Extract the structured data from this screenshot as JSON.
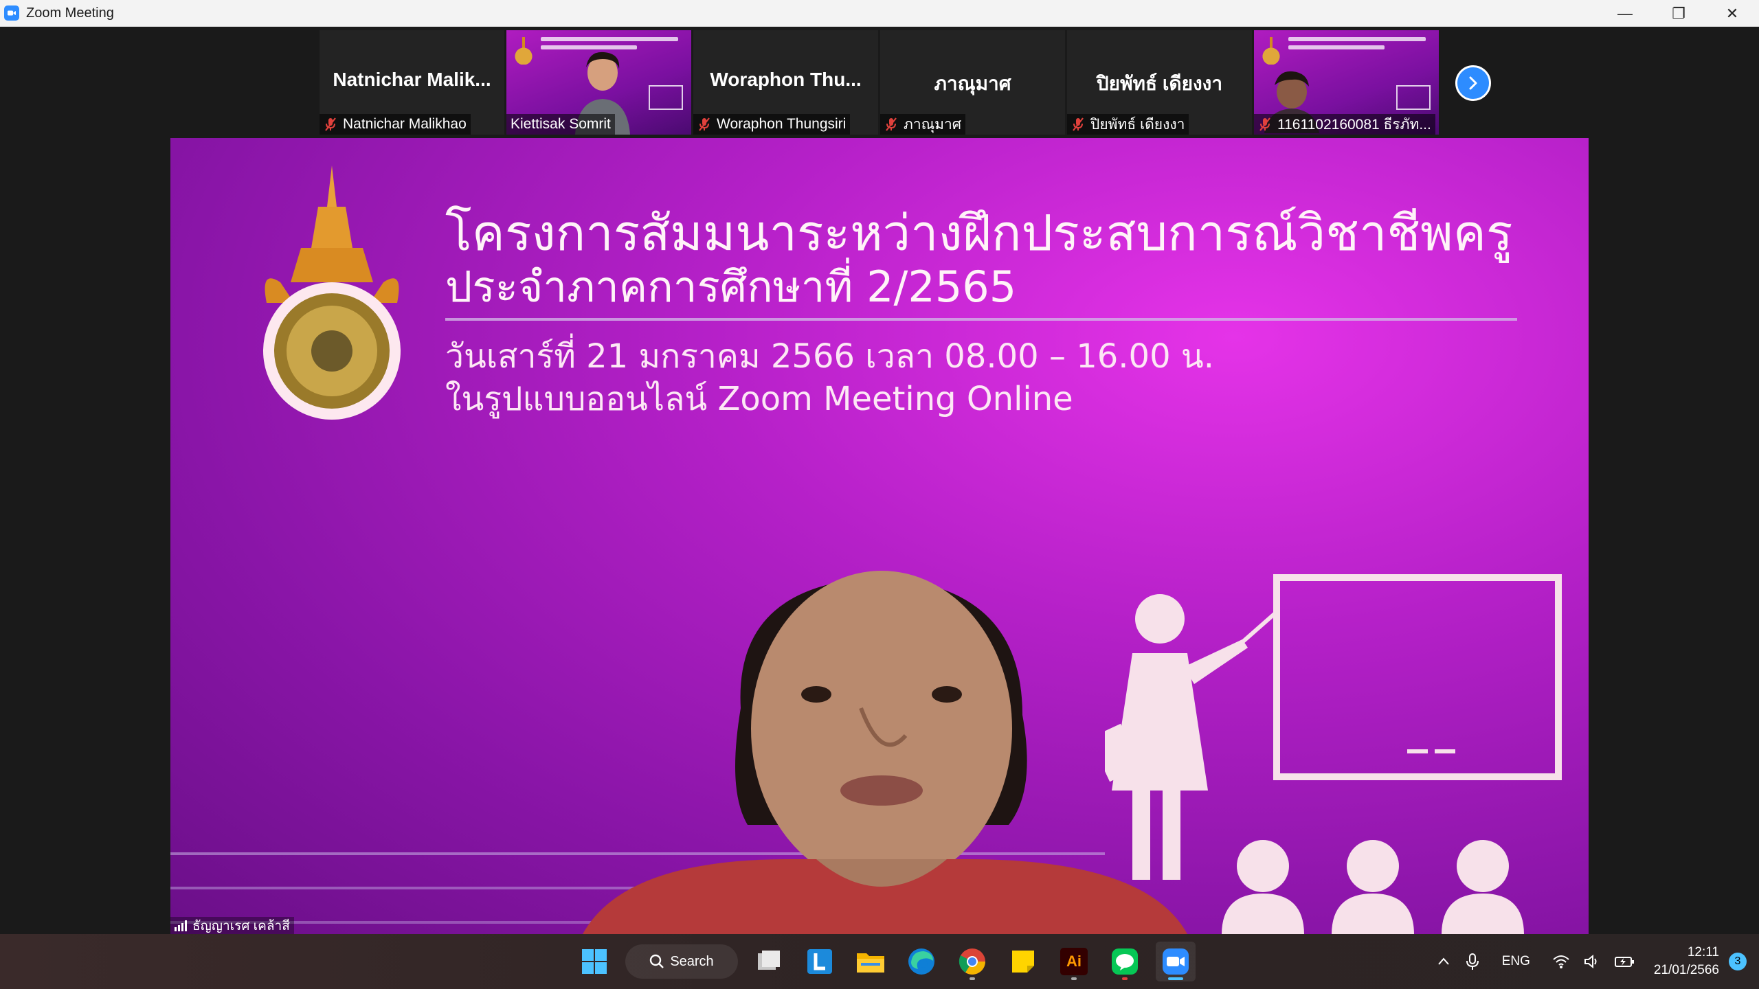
{
  "window": {
    "title": "Zoom Meeting",
    "controls": {
      "minimize": "—",
      "restore": "❐",
      "close": "✕"
    }
  },
  "filmstrip": {
    "tiles": [
      {
        "display_name": "Natnichar  Malik...",
        "label": "Natnichar Malikhao",
        "video": false
      },
      {
        "display_name": "",
        "label": "Kiettisak Somrit",
        "video": true
      },
      {
        "display_name": "Woraphon  Thu...",
        "label": "Woraphon Thungsiri",
        "video": false
      },
      {
        "display_name": "ภาณุมาศ",
        "label": "ภาณุมาศ",
        "video": false
      },
      {
        "display_name": "ปิยพัทธ์ เดียงงา",
        "label": "ปิยพัทธ์ เดียงงา",
        "video": false
      },
      {
        "display_name": "",
        "label": "1161102160081 ธีรภัท...",
        "video": true
      }
    ],
    "next_icon": "chevron-right-icon"
  },
  "main_video": {
    "slide": {
      "line1": "โครงการสัมมนาระหว่างฝึกประสบการณ์วิชาชีพครู",
      "line2": "ประจำภาคการศึกษาที่ 2/2565",
      "line3": "วันเสาร์ที่ 21 มกราคม 2566 เวลา 08.00 – 16.00 น.",
      "line4": "ในรูปแบบออนไลน์ Zoom Meeting Online"
    },
    "speaker_name": "ธัญญาเรศ เคล้าสี"
  },
  "taskbar": {
    "search_label": "Search",
    "apps": [
      "windows-start-icon",
      "task-view-icon",
      "l-app-icon",
      "file-explorer-icon",
      "edge-icon",
      "chrome-icon",
      "sticky-notes-icon",
      "illustrator-icon",
      "line-icon",
      "zoom-icon"
    ],
    "illustrator_label": "Ai",
    "language": "ENG",
    "time": "12:11",
    "date": "21/01/2566",
    "notification_count": "3"
  },
  "colors": {
    "zoom_blue": "#2d8cff",
    "slide_magenta": "#b520c8",
    "muted_red": "#e0413c"
  }
}
